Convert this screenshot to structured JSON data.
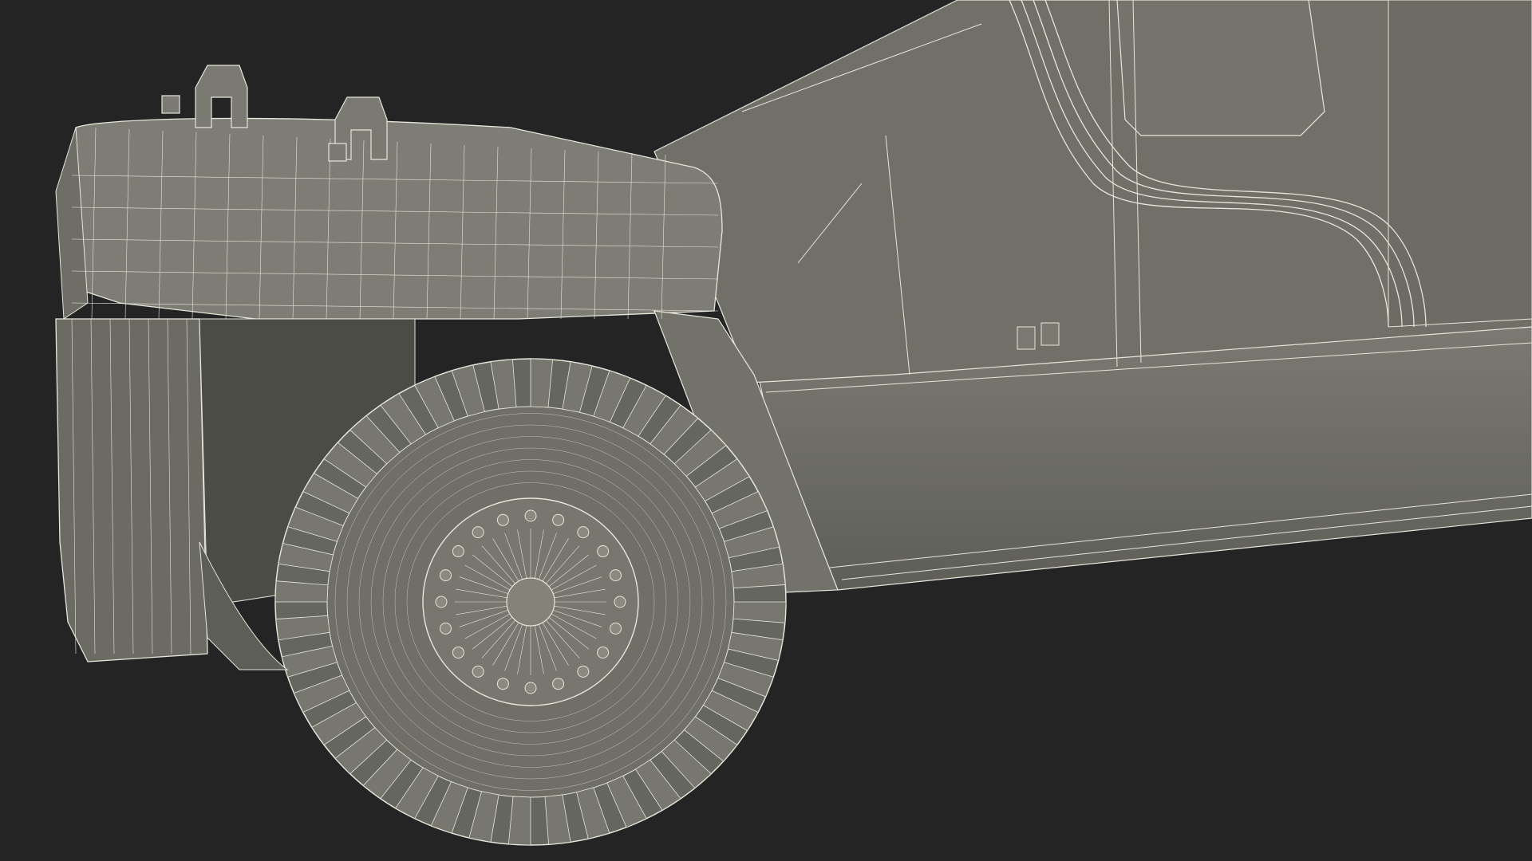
{
  "scene": {
    "background": "#242424",
    "body_fill": "#6d6d66",
    "body_fill_dark": "#55554f",
    "wire_color": "#e6e6dc",
    "tire_fill": "#6a6a63",
    "hub_fill": "#777770"
  }
}
